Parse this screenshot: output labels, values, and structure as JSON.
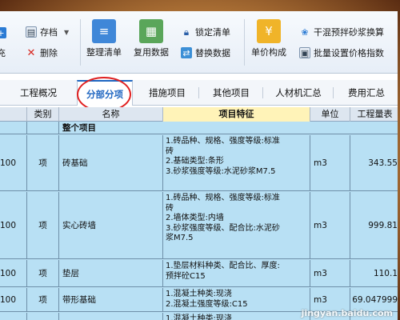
{
  "toolbar": {
    "left_cut": "充",
    "save_label": "存档",
    "delete_label": "删除",
    "organize_label": "整理清单",
    "reuse_label": "复用数据",
    "lock_label": "锁定清单",
    "replace_label": "替换数据",
    "unit_price_label": "单价构成",
    "mortar_label": "干混预拌砂浆换算",
    "batch_label": "批量设置价格指数"
  },
  "tabs": [
    "工程概况",
    "分部分项",
    "措施项目",
    "其他项目",
    "人材机汇总",
    "费用汇总"
  ],
  "active_tab": "分部分项",
  "table": {
    "headers": [
      "",
      "类别",
      "名称",
      "项目特征",
      "单位",
      "工程量表"
    ],
    "group_row": "整个项目",
    "rows": [
      {
        "code": "100",
        "type": "项",
        "name": "砖基础",
        "feature": "1.砖品种、规格、强度等级:标准\n砖\n2.基础类型:条形\n3.砂浆强度等级:水泥砂浆M7.5",
        "unit": "m3",
        "qty": "343.55"
      },
      {
        "code": "100",
        "type": "项",
        "name": "实心砖墙",
        "feature": "1.砖品种、规格、强度等级:标准\n砖\n2.墙体类型:内墙\n3.砂浆强度等级、配合比:水泥砂\n浆M7.5",
        "unit": "m3",
        "qty": "999.81"
      },
      {
        "code": "100",
        "type": "项",
        "name": "垫层",
        "feature": "1.垫层材料种类、配合比、厚度:\n预拌砼C15",
        "unit": "m3",
        "qty": "110.1"
      },
      {
        "code": "100",
        "type": "项",
        "name": "带形基础",
        "feature": "1.混凝土种类:现浇\n2.混凝土强度等级:C15",
        "unit": "m3",
        "qty": "69.047999"
      },
      {
        "code": "",
        "type": "",
        "name": "",
        "feature": "1.混凝土种类:现浇",
        "unit": "",
        "qty": ""
      }
    ]
  },
  "watermark": "jingyan.baidu.com",
  "colors": {
    "accent": "#1f66c1",
    "row_bg": "#b8e0f4",
    "feature_header": "#fff3b8",
    "highlight_circle": "#e02020"
  }
}
